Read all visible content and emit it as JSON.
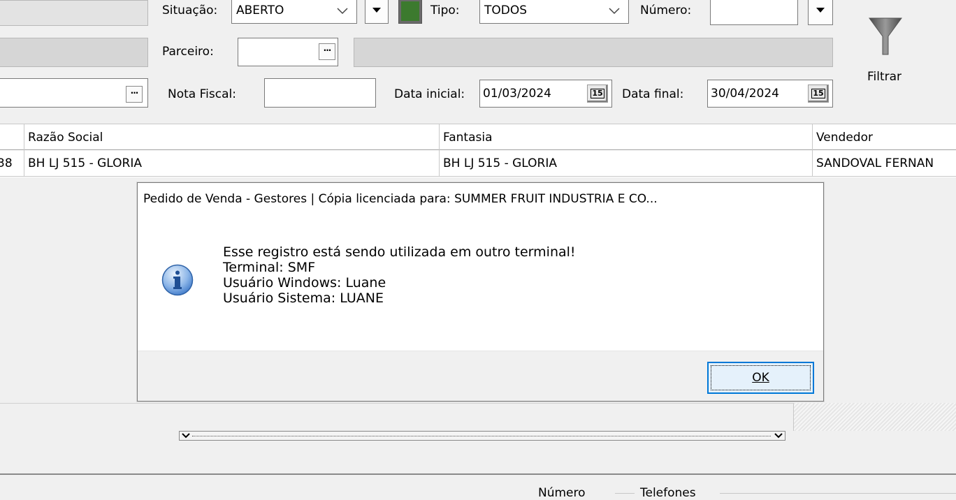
{
  "filters": {
    "situacao_label": "Situação:",
    "situacao_value": "ABERTO",
    "tipo_label": "Tipo:",
    "tipo_value": "TODOS",
    "numero_label": "Número:",
    "numero_value": "",
    "parceiro_label": "Parceiro:",
    "parceiro_value": "",
    "nota_fiscal_label": "Nota Fiscal:",
    "nota_fiscal_value": "",
    "data_inicial_label": "Data inicial:",
    "data_inicial_value": "01/03/2024",
    "data_final_label": "Data final:",
    "data_final_value": "30/04/2024",
    "calendar_icon_text": "15",
    "lookup_button_text": "···",
    "filtrar_label": "Filtrar",
    "status_color": "#3c7a2e"
  },
  "grid": {
    "columns": [
      "Razão Social",
      "Fantasia",
      "Vendedor"
    ],
    "rows": [
      {
        "prefix": "38",
        "razao_social": "BH LJ 515 - GLORIA",
        "fantasia": "BH LJ 515 - GLORIA",
        "vendedor": "SANDOVAL FERNAN"
      }
    ]
  },
  "dialog": {
    "title": "Pedido de Venda - Gestores | Cópia licenciada para: SUMMER FRUIT INDUSTRIA E CO...",
    "message_lines": [
      "Esse registro está sendo utilizada em outro terminal!",
      "Terminal: SMF",
      "Usuário Windows: Luane",
      "Usuário Sistema: LUANE"
    ],
    "icon": "info-icon",
    "ok_label": "OK"
  },
  "bottom": {
    "numero_label": "Número",
    "telefones_label": "Telefones"
  }
}
